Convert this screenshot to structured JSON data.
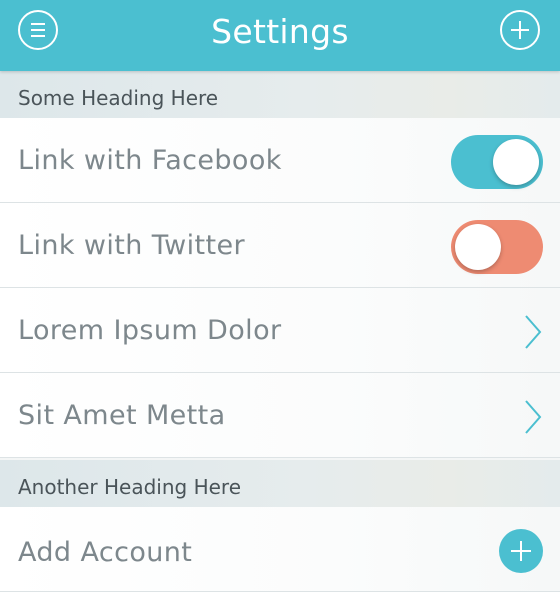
{
  "header": {
    "title": "Settings",
    "menu_icon": "hamburger-menu-icon",
    "add_icon": "plus-icon"
  },
  "sections": [
    {
      "heading": "Some Heading Here",
      "rows": [
        {
          "label": "Link with Facebook",
          "control": "toggle",
          "on": true
        },
        {
          "label": "Link with Twitter",
          "control": "toggle",
          "on": false
        },
        {
          "label": "Lorem Ipsum Dolor",
          "control": "chevron-right-icon"
        },
        {
          "label": "Sit Amet Metta",
          "control": "chevron-right-icon"
        }
      ]
    },
    {
      "heading": "Another Heading Here",
      "rows": [
        {
          "label": "Add Account",
          "control": "plus-circle-icon"
        }
      ]
    }
  ],
  "colors": {
    "accent": "#4bbfd0",
    "toggle_off": "#ee8b72",
    "label_text": "#7d878c",
    "heading_text": "#4a5459"
  }
}
